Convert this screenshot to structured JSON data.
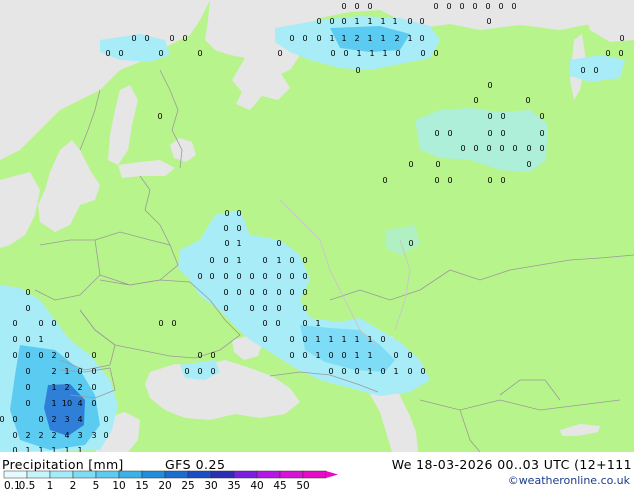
{
  "footer": {
    "title": "Precipitation [mm]",
    "model": "GFS 0.25",
    "valid_time": "We 18-03-2026 00..03 UTC (12+111",
    "credit": "©weatheronline.co.uk"
  },
  "legend": {
    "ticks": [
      "0.1",
      "0.5",
      "1",
      "2",
      "5",
      "10",
      "15",
      "20",
      "25",
      "30",
      "35",
      "40",
      "45",
      "50"
    ],
    "colors": [
      "#e6fbff",
      "#c6f4fc",
      "#a4ebfa",
      "#7fdcf6",
      "#5ccbf2",
      "#38b3ea",
      "#1f8fdd",
      "#1a6dd1",
      "#1b4ec4",
      "#2a2fb5",
      "#7a1ee0",
      "#b418e6",
      "#d911d9",
      "#e80ac8"
    ]
  },
  "map_colors": {
    "land": "#b8f48c",
    "sea": "#e6e6e6",
    "border": "#9a9a9a",
    "precip_light": "#a8ecf8",
    "precip_mid": "#5ccbf2",
    "precip_heavy": "#2f7fd8"
  },
  "precip_labels": [
    {
      "t": "0",
      "lon": 317,
      "lat": 21
    },
    {
      "t": "0",
      "lon": 330,
      "lat": 21
    },
    {
      "t": "0",
      "lon": 342,
      "lat": 21
    },
    {
      "t": "1",
      "lon": 355,
      "lat": 21
    },
    {
      "t": "1",
      "lon": 368,
      "lat": 21
    },
    {
      "t": "1",
      "lon": 381,
      "lat": 21
    },
    {
      "t": "1",
      "lon": 393,
      "lat": 21
    },
    {
      "t": "0",
      "lon": 408,
      "lat": 21
    },
    {
      "t": "0",
      "lon": 420,
      "lat": 21
    },
    {
      "t": "0",
      "lon": 434,
      "lat": 6
    },
    {
      "t": "0",
      "lon": 447,
      "lat": 6
    },
    {
      "t": "0",
      "lon": 460,
      "lat": 6
    },
    {
      "t": "0",
      "lon": 473,
      "lat": 6
    },
    {
      "t": "0",
      "lon": 486,
      "lat": 6
    },
    {
      "t": "0",
      "lon": 499,
      "lat": 6
    },
    {
      "t": "0",
      "lon": 512,
      "lat": 6
    },
    {
      "t": "0",
      "lon": 487,
      "lat": 21
    },
    {
      "t": "0",
      "lon": 342,
      "lat": 6
    },
    {
      "t": "0",
      "lon": 355,
      "lat": 6
    },
    {
      "t": "0",
      "lon": 368,
      "lat": 6
    },
    {
      "t": "0",
      "lon": 132,
      "lat": 38
    },
    {
      "t": "0",
      "lon": 145,
      "lat": 38
    },
    {
      "t": "0",
      "lon": 170,
      "lat": 38
    },
    {
      "t": "0",
      "lon": 183,
      "lat": 38
    },
    {
      "t": "0",
      "lon": 290,
      "lat": 38
    },
    {
      "t": "0",
      "lon": 303,
      "lat": 38
    },
    {
      "t": "0",
      "lon": 317,
      "lat": 38
    },
    {
      "t": "1",
      "lon": 330,
      "lat": 38
    },
    {
      "t": "1",
      "lon": 342,
      "lat": 38
    },
    {
      "t": "2",
      "lon": 355,
      "lat": 38
    },
    {
      "t": "1",
      "lon": 368,
      "lat": 38
    },
    {
      "t": "1",
      "lon": 381,
      "lat": 38
    },
    {
      "t": "2",
      "lon": 395,
      "lat": 38
    },
    {
      "t": "1",
      "lon": 408,
      "lat": 38
    },
    {
      "t": "0",
      "lon": 420,
      "lat": 38
    },
    {
      "t": "0",
      "lon": 620,
      "lat": 38
    },
    {
      "t": "0",
      "lon": 106,
      "lat": 53
    },
    {
      "t": "0",
      "lon": 119,
      "lat": 53
    },
    {
      "t": "0",
      "lon": 159,
      "lat": 53
    },
    {
      "t": "0",
      "lon": 198,
      "lat": 53
    },
    {
      "t": "0",
      "lon": 278,
      "lat": 53
    },
    {
      "t": "0",
      "lon": 331,
      "lat": 53
    },
    {
      "t": "0",
      "lon": 344,
      "lat": 53
    },
    {
      "t": "1",
      "lon": 357,
      "lat": 53
    },
    {
      "t": "1",
      "lon": 370,
      "lat": 53
    },
    {
      "t": "1",
      "lon": 383,
      "lat": 53
    },
    {
      "t": "0",
      "lon": 396,
      "lat": 53
    },
    {
      "t": "0",
      "lon": 421,
      "lat": 53
    },
    {
      "t": "0",
      "lon": 434,
      "lat": 53
    },
    {
      "t": "0",
      "lon": 606,
      "lat": 53
    },
    {
      "t": "0",
      "lon": 619,
      "lat": 53
    },
    {
      "t": "0",
      "lon": 356,
      "lat": 70
    },
    {
      "t": "0",
      "lon": 581,
      "lat": 70
    },
    {
      "t": "0",
      "lon": 594,
      "lat": 70
    },
    {
      "t": "0",
      "lon": 488,
      "lat": 85
    },
    {
      "t": "0",
      "lon": 474,
      "lat": 100
    },
    {
      "t": "0",
      "lon": 526,
      "lat": 100
    },
    {
      "t": "0",
      "lon": 158,
      "lat": 116
    },
    {
      "t": "0",
      "lon": 488,
      "lat": 116
    },
    {
      "t": "0",
      "lon": 501,
      "lat": 116
    },
    {
      "t": "0",
      "lon": 540,
      "lat": 116
    },
    {
      "t": "0",
      "lon": 435,
      "lat": 133
    },
    {
      "t": "0",
      "lon": 448,
      "lat": 133
    },
    {
      "t": "0",
      "lon": 488,
      "lat": 133
    },
    {
      "t": "0",
      "lon": 501,
      "lat": 133
    },
    {
      "t": "0",
      "lon": 540,
      "lat": 133
    },
    {
      "t": "0",
      "lon": 461,
      "lat": 148
    },
    {
      "t": "0",
      "lon": 474,
      "lat": 148
    },
    {
      "t": "0",
      "lon": 487,
      "lat": 148
    },
    {
      "t": "0",
      "lon": 500,
      "lat": 148
    },
    {
      "t": "0",
      "lon": 513,
      "lat": 148
    },
    {
      "t": "0",
      "lon": 527,
      "lat": 148
    },
    {
      "t": "0",
      "lon": 540,
      "lat": 148
    },
    {
      "t": "0",
      "lon": 409,
      "lat": 164
    },
    {
      "t": "0",
      "lon": 436,
      "lat": 164
    },
    {
      "t": "0",
      "lon": 527,
      "lat": 164
    },
    {
      "t": "0",
      "lon": 383,
      "lat": 180
    },
    {
      "t": "0",
      "lon": 435,
      "lat": 180
    },
    {
      "t": "0",
      "lon": 448,
      "lat": 180
    },
    {
      "t": "0",
      "lon": 488,
      "lat": 180
    },
    {
      "t": "0",
      "lon": 501,
      "lat": 180
    },
    {
      "t": "0",
      "lon": 225,
      "lat": 213
    },
    {
      "t": "0",
      "lon": 237,
      "lat": 213
    },
    {
      "t": "0",
      "lon": 224,
      "lat": 228
    },
    {
      "t": "0",
      "lon": 237,
      "lat": 228
    },
    {
      "t": "0",
      "lon": 225,
      "lat": 243
    },
    {
      "t": "1",
      "lon": 237,
      "lat": 243
    },
    {
      "t": "0",
      "lon": 277,
      "lat": 243
    },
    {
      "t": "0",
      "lon": 409,
      "lat": 243
    },
    {
      "t": "0",
      "lon": 210,
      "lat": 260
    },
    {
      "t": "0",
      "lon": 224,
      "lat": 260
    },
    {
      "t": "1",
      "lon": 237,
      "lat": 260
    },
    {
      "t": "0",
      "lon": 263,
      "lat": 260
    },
    {
      "t": "1",
      "lon": 277,
      "lat": 260
    },
    {
      "t": "0",
      "lon": 290,
      "lat": 260
    },
    {
      "t": "0",
      "lon": 303,
      "lat": 260
    },
    {
      "t": "0",
      "lon": 198,
      "lat": 276
    },
    {
      "t": "0",
      "lon": 210,
      "lat": 276
    },
    {
      "t": "0",
      "lon": 224,
      "lat": 276
    },
    {
      "t": "0",
      "lon": 237,
      "lat": 276
    },
    {
      "t": "0",
      "lon": 250,
      "lat": 276
    },
    {
      "t": "0",
      "lon": 263,
      "lat": 276
    },
    {
      "t": "0",
      "lon": 277,
      "lat": 276
    },
    {
      "t": "0",
      "lon": 290,
      "lat": 276
    },
    {
      "t": "0",
      "lon": 303,
      "lat": 276
    },
    {
      "t": "0",
      "lon": 224,
      "lat": 292
    },
    {
      "t": "0",
      "lon": 237,
      "lat": 292
    },
    {
      "t": "0",
      "lon": 250,
      "lat": 292
    },
    {
      "t": "0",
      "lon": 263,
      "lat": 292
    },
    {
      "t": "0",
      "lon": 277,
      "lat": 292
    },
    {
      "t": "0",
      "lon": 290,
      "lat": 292
    },
    {
      "t": "0",
      "lon": 303,
      "lat": 292
    },
    {
      "t": "0",
      "lon": 26,
      "lat": 292
    },
    {
      "t": "0",
      "lon": 224,
      "lat": 308
    },
    {
      "t": "0",
      "lon": 250,
      "lat": 308
    },
    {
      "t": "0",
      "lon": 263,
      "lat": 308
    },
    {
      "t": "0",
      "lon": 277,
      "lat": 308
    },
    {
      "t": "0",
      "lon": 303,
      "lat": 308
    },
    {
      "t": "0",
      "lon": 26,
      "lat": 308
    },
    {
      "t": "0",
      "lon": 13,
      "lat": 323
    },
    {
      "t": "0",
      "lon": 39,
      "lat": 323
    },
    {
      "t": "0",
      "lon": 52,
      "lat": 323
    },
    {
      "t": "0",
      "lon": 159,
      "lat": 323
    },
    {
      "t": "0",
      "lon": 172,
      "lat": 323
    },
    {
      "t": "0",
      "lon": 263,
      "lat": 323
    },
    {
      "t": "0",
      "lon": 276,
      "lat": 323
    },
    {
      "t": "0",
      "lon": 303,
      "lat": 323
    },
    {
      "t": "1",
      "lon": 316,
      "lat": 323
    },
    {
      "t": "0",
      "lon": 13,
      "lat": 339
    },
    {
      "t": "0",
      "lon": 26,
      "lat": 339
    },
    {
      "t": "1",
      "lon": 39,
      "lat": 339
    },
    {
      "t": "0",
      "lon": 263,
      "lat": 339
    },
    {
      "t": "0",
      "lon": 290,
      "lat": 339
    },
    {
      "t": "0",
      "lon": 303,
      "lat": 339
    },
    {
      "t": "1",
      "lon": 316,
      "lat": 339
    },
    {
      "t": "1",
      "lon": 329,
      "lat": 339
    },
    {
      "t": "1",
      "lon": 342,
      "lat": 339
    },
    {
      "t": "1",
      "lon": 355,
      "lat": 339
    },
    {
      "t": "1",
      "lon": 368,
      "lat": 339
    },
    {
      "t": "0",
      "lon": 381,
      "lat": 339
    },
    {
      "t": "0",
      "lon": 13,
      "lat": 355
    },
    {
      "t": "0",
      "lon": 26,
      "lat": 355
    },
    {
      "t": "0",
      "lon": 39,
      "lat": 355
    },
    {
      "t": "2",
      "lon": 52,
      "lat": 355
    },
    {
      "t": "0",
      "lon": 65,
      "lat": 355
    },
    {
      "t": "0",
      "lon": 92,
      "lat": 355
    },
    {
      "t": "0",
      "lon": 198,
      "lat": 355
    },
    {
      "t": "0",
      "lon": 211,
      "lat": 355
    },
    {
      "t": "0",
      "lon": 290,
      "lat": 355
    },
    {
      "t": "0",
      "lon": 303,
      "lat": 355
    },
    {
      "t": "1",
      "lon": 316,
      "lat": 355
    },
    {
      "t": "0",
      "lon": 329,
      "lat": 355
    },
    {
      "t": "0",
      "lon": 342,
      "lat": 355
    },
    {
      "t": "1",
      "lon": 355,
      "lat": 355
    },
    {
      "t": "1",
      "lon": 368,
      "lat": 355
    },
    {
      "t": "0",
      "lon": 394,
      "lat": 355
    },
    {
      "t": "0",
      "lon": 408,
      "lat": 355
    },
    {
      "t": "0",
      "lon": 26,
      "lat": 371
    },
    {
      "t": "2",
      "lon": 52,
      "lat": 371
    },
    {
      "t": "1",
      "lon": 65,
      "lat": 371
    },
    {
      "t": "0",
      "lon": 78,
      "lat": 371
    },
    {
      "t": "0",
      "lon": 92,
      "lat": 371
    },
    {
      "t": "0",
      "lon": 185,
      "lat": 371
    },
    {
      "t": "0",
      "lon": 198,
      "lat": 371
    },
    {
      "t": "0",
      "lon": 211,
      "lat": 371
    },
    {
      "t": "0",
      "lon": 329,
      "lat": 371
    },
    {
      "t": "0",
      "lon": 342,
      "lat": 371
    },
    {
      "t": "0",
      "lon": 355,
      "lat": 371
    },
    {
      "t": "1",
      "lon": 368,
      "lat": 371
    },
    {
      "t": "0",
      "lon": 381,
      "lat": 371
    },
    {
      "t": "1",
      "lon": 394,
      "lat": 371
    },
    {
      "t": "0",
      "lon": 408,
      "lat": 371
    },
    {
      "t": "0",
      "lon": 421,
      "lat": 371
    },
    {
      "t": "0",
      "lon": 26,
      "lat": 387
    },
    {
      "t": "1",
      "lon": 52,
      "lat": 387
    },
    {
      "t": "2",
      "lon": 65,
      "lat": 387
    },
    {
      "t": "2",
      "lon": 78,
      "lat": 387
    },
    {
      "t": "0",
      "lon": 92,
      "lat": 387
    },
    {
      "t": "0",
      "lon": 26,
      "lat": 403
    },
    {
      "t": "1",
      "lon": 52,
      "lat": 403
    },
    {
      "t": "10",
      "lon": 65,
      "lat": 403
    },
    {
      "t": "4",
      "lon": 78,
      "lat": 403
    },
    {
      "t": "0",
      "lon": 92,
      "lat": 403
    },
    {
      "t": "0",
      "lon": 0,
      "lat": 419
    },
    {
      "t": "0",
      "lon": 13,
      "lat": 419
    },
    {
      "t": "0",
      "lon": 39,
      "lat": 419
    },
    {
      "t": "2",
      "lon": 52,
      "lat": 419
    },
    {
      "t": "3",
      "lon": 65,
      "lat": 419
    },
    {
      "t": "4",
      "lon": 78,
      "lat": 419
    },
    {
      "t": "0",
      "lon": 104,
      "lat": 419
    },
    {
      "t": "0",
      "lon": 13,
      "lat": 435
    },
    {
      "t": "2",
      "lon": 26,
      "lat": 435
    },
    {
      "t": "2",
      "lon": 39,
      "lat": 435
    },
    {
      "t": "2",
      "lon": 52,
      "lat": 435
    },
    {
      "t": "4",
      "lon": 65,
      "lat": 435
    },
    {
      "t": "3",
      "lon": 78,
      "lat": 435
    },
    {
      "t": "3",
      "lon": 92,
      "lat": 435
    },
    {
      "t": "0",
      "lon": 104,
      "lat": 435
    },
    {
      "t": "0",
      "lon": 13,
      "lat": 450
    },
    {
      "t": "1",
      "lon": 26,
      "lat": 450
    },
    {
      "t": "1",
      "lon": 39,
      "lat": 450
    },
    {
      "t": "1",
      "lon": 52,
      "lat": 450
    },
    {
      "t": "1",
      "lon": 65,
      "lat": 450
    },
    {
      "t": "1",
      "lon": 78,
      "lat": 450
    }
  ]
}
